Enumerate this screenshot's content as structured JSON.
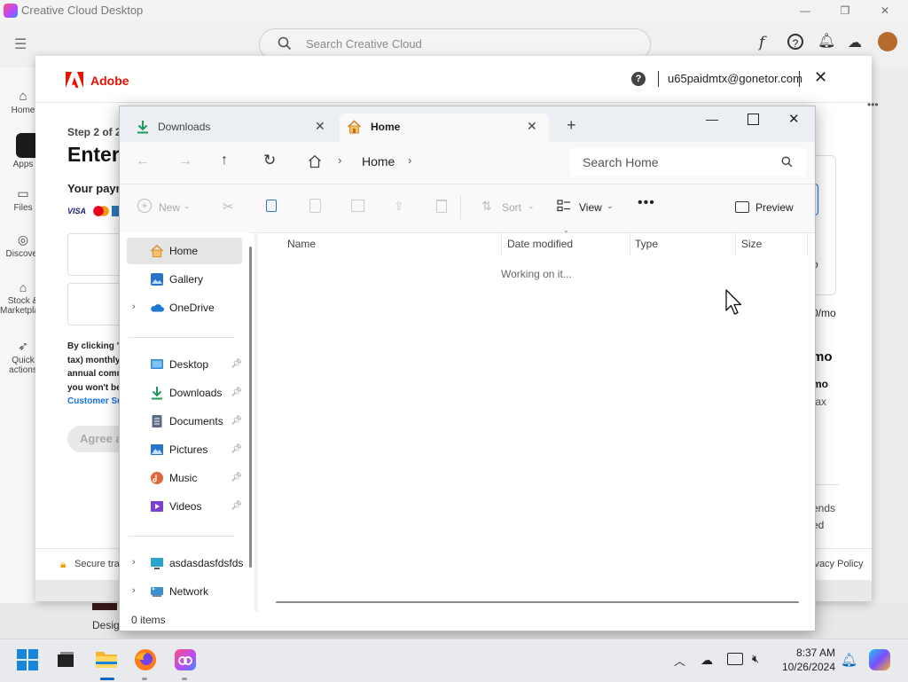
{
  "cc": {
    "title": "Creative Cloud Desktop",
    "search_placeholder": "Search Creative Cloud",
    "sidebar": [
      "Home",
      "Apps",
      "Files",
      "Discover",
      "Stock & Marketplace",
      "Quick actions"
    ],
    "bottom_label": "Desig"
  },
  "adobe": {
    "brand": "Adobe",
    "account": "u65paidmtx@gonetor.com",
    "step": "Step 2 of 2",
    "heading": "Enter",
    "payment_label": "Your payment",
    "card_logos": [
      "VISA",
      "mastercard",
      "amex"
    ],
    "terms": [
      "By clicking \"Agree...",
      "tax) monthly...",
      "annual comm...",
      "you won't be...",
      "Customer Sup..."
    ],
    "agree": "Agree a...",
    "right_values": [
      "o",
      "0/mo",
      "mo",
      "mo",
      "tax",
      "ends",
      "ed"
    ],
    "secure": "Secure tran",
    "privacy": "ivacy Policy"
  },
  "explorer": {
    "tabs": [
      {
        "label": "Downloads",
        "icon": "downloads-icon"
      },
      {
        "label": "Home",
        "icon": "home-icon"
      }
    ],
    "breadcrumb": "Home",
    "search_placeholder": "Search Home",
    "toolbar": {
      "new": "New",
      "sort": "Sort",
      "view": "View",
      "preview": "Preview"
    },
    "nav": {
      "top": [
        "Home",
        "Gallery",
        "OneDrive"
      ],
      "quick": [
        {
          "label": "Desktop",
          "color": "#2e8ad8"
        },
        {
          "label": "Downloads",
          "color": "#1e9a5a"
        },
        {
          "label": "Documents",
          "color": "#5a6b82"
        },
        {
          "label": "Pictures",
          "color": "#2b73c7"
        },
        {
          "label": "Music",
          "color": "#e0683a"
        },
        {
          "label": "Videos",
          "color": "#7b3fd1"
        }
      ],
      "bottom": [
        "asdasdasfdsfds",
        "Network"
      ]
    },
    "columns": [
      "Name",
      "Date modified",
      "Type",
      "Size"
    ],
    "loading": "Working on it...",
    "status": "0 items"
  },
  "taskbar": {
    "time": "8:37 AM",
    "date": "10/26/2024"
  },
  "colors": {
    "adobe_red": "#eb1000",
    "accent": "#0067c0",
    "selected_nav": "#e5e5e5"
  }
}
